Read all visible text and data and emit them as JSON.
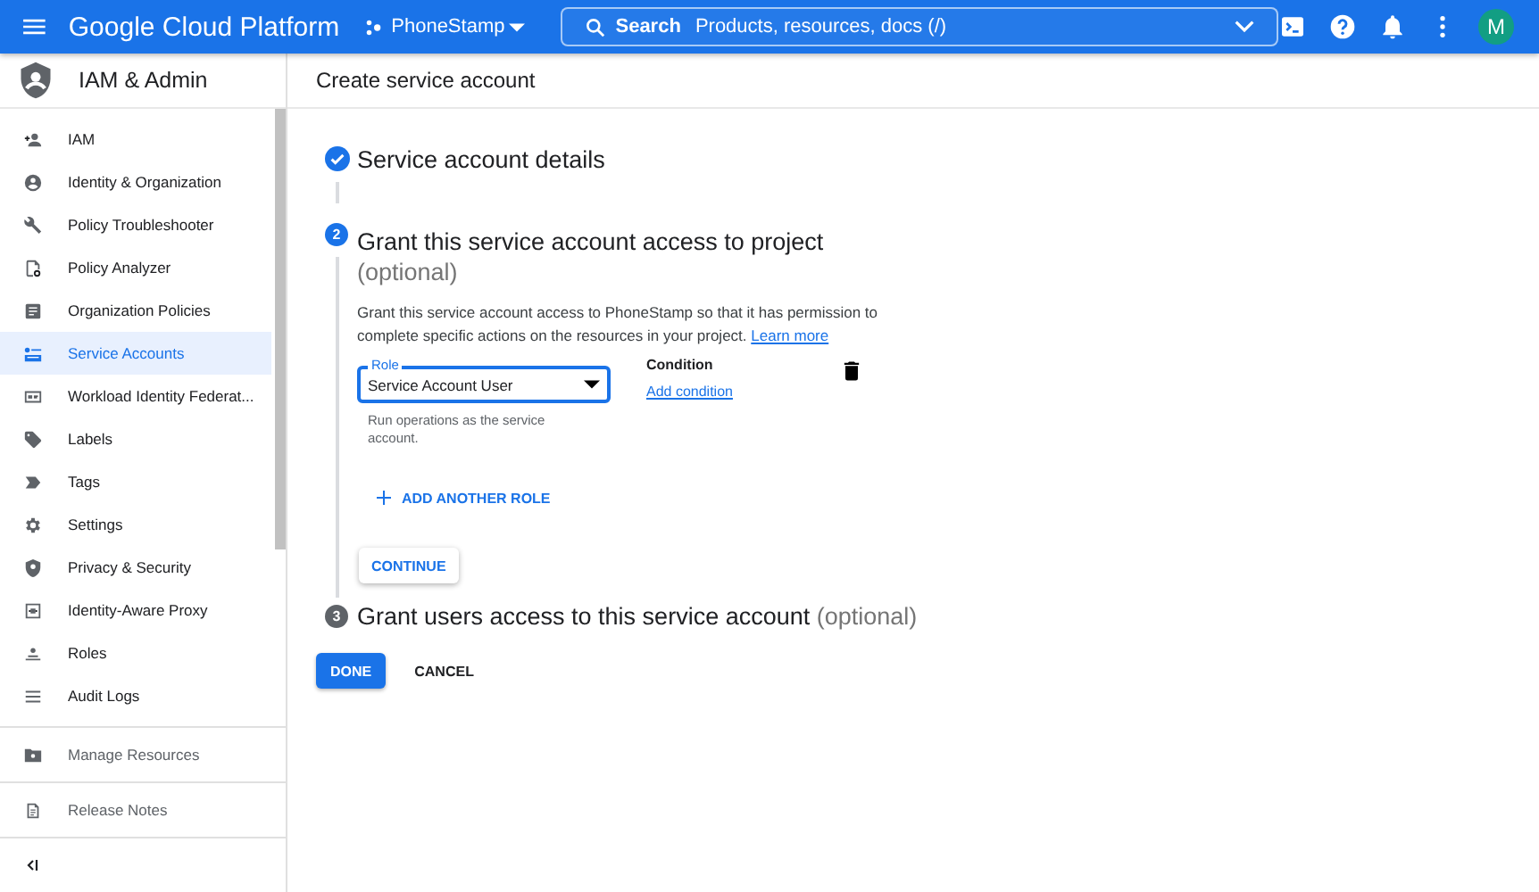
{
  "topbar": {
    "product": "Google Cloud Platform",
    "project": "PhoneStamp",
    "search": {
      "label": "Search",
      "placeholder": "Products, resources, docs (/)"
    },
    "avatar": "M"
  },
  "sidebar": {
    "title": "IAM & Admin",
    "items": [
      {
        "label": "IAM",
        "selected": false
      },
      {
        "label": "Identity & Organization",
        "selected": false
      },
      {
        "label": "Policy Troubleshooter",
        "selected": false
      },
      {
        "label": "Policy Analyzer",
        "selected": false
      },
      {
        "label": "Organization Policies",
        "selected": false
      },
      {
        "label": "Service Accounts",
        "selected": true
      },
      {
        "label": "Workload Identity Federat...",
        "selected": false
      },
      {
        "label": "Labels",
        "selected": false
      },
      {
        "label": "Tags",
        "selected": false
      },
      {
        "label": "Settings",
        "selected": false
      },
      {
        "label": "Privacy & Security",
        "selected": false
      },
      {
        "label": "Identity-Aware Proxy",
        "selected": false
      },
      {
        "label": "Roles",
        "selected": false
      },
      {
        "label": "Audit Logs",
        "selected": false
      }
    ],
    "footer": [
      {
        "label": "Manage Resources"
      },
      {
        "label": "Release Notes"
      }
    ]
  },
  "page_title": "Create service account",
  "steps": [
    {
      "kind": "done",
      "title": "Service account details"
    },
    {
      "kind": "active",
      "number": "2",
      "title": "Grant this service account access to project",
      "optional": "(optional)",
      "description": "Grant this service account access to PhoneStamp so that it has permission to complete specific actions on the resources in your project.",
      "link": "Learn more",
      "role": {
        "label": "Role",
        "value": "Service Account User",
        "hint": "Run operations as the service account."
      },
      "condition": {
        "label": "Condition",
        "link": "Add condition"
      },
      "add_role": "ADD ANOTHER ROLE",
      "continue": "CONTINUE"
    },
    {
      "kind": "pending",
      "number": "3",
      "title": "Grant users access to this service account",
      "optional": "(optional)"
    }
  ],
  "actions": {
    "done": "DONE",
    "cancel": "CANCEL"
  }
}
